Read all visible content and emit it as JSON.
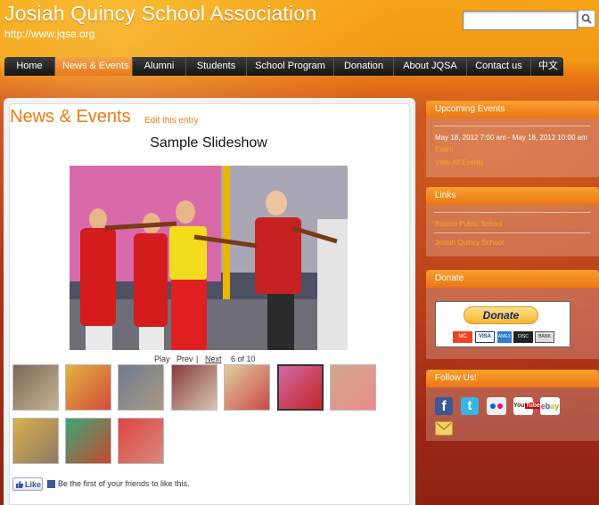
{
  "header": {
    "title": "Josiah Quincy School Association",
    "url": "http://www.jqsa.org"
  },
  "search": {
    "placeholder": ""
  },
  "nav": {
    "items": [
      "Home",
      "News & Events",
      "Alumni",
      "Students",
      "School Program",
      "Donation",
      "About JQSA",
      "Contact us",
      "中文"
    ],
    "active": "News & Events"
  },
  "main": {
    "title": "News & Events",
    "edit_link": "Edit this entry",
    "slideshow": {
      "title": "Sample Slideshow",
      "play": "Play",
      "prev": "Prev",
      "separator": "|",
      "next": "Next",
      "counter": "6 of 10"
    },
    "like": {
      "button": "Like",
      "text": "Be the first of your friends to like this."
    }
  },
  "sidebar": {
    "upcoming": {
      "heading": "Upcoming Events",
      "date": "May 18, 2012 7:00 am - May 18, 2012 10:00 am",
      "event": "Event",
      "view_all": "View All Events"
    },
    "links": {
      "heading": "Links",
      "items": [
        "Boston Public School",
        "Josiah Quincy School"
      ]
    },
    "donate": {
      "heading": "Donate",
      "button": "Donate",
      "cards": [
        "MC",
        "VISA",
        "AMEX",
        "DISC",
        "BANK"
      ]
    },
    "follow": {
      "heading": "Follow Us!",
      "icons": [
        "facebook-icon",
        "twitter-icon",
        "flickr-icon",
        "youtube-icon",
        "ebay-icon",
        "email-icon"
      ]
    }
  },
  "colors": {
    "accent": "#ef7a12",
    "nav_bg": "#1e1e1e",
    "link": "#f7a91a"
  }
}
